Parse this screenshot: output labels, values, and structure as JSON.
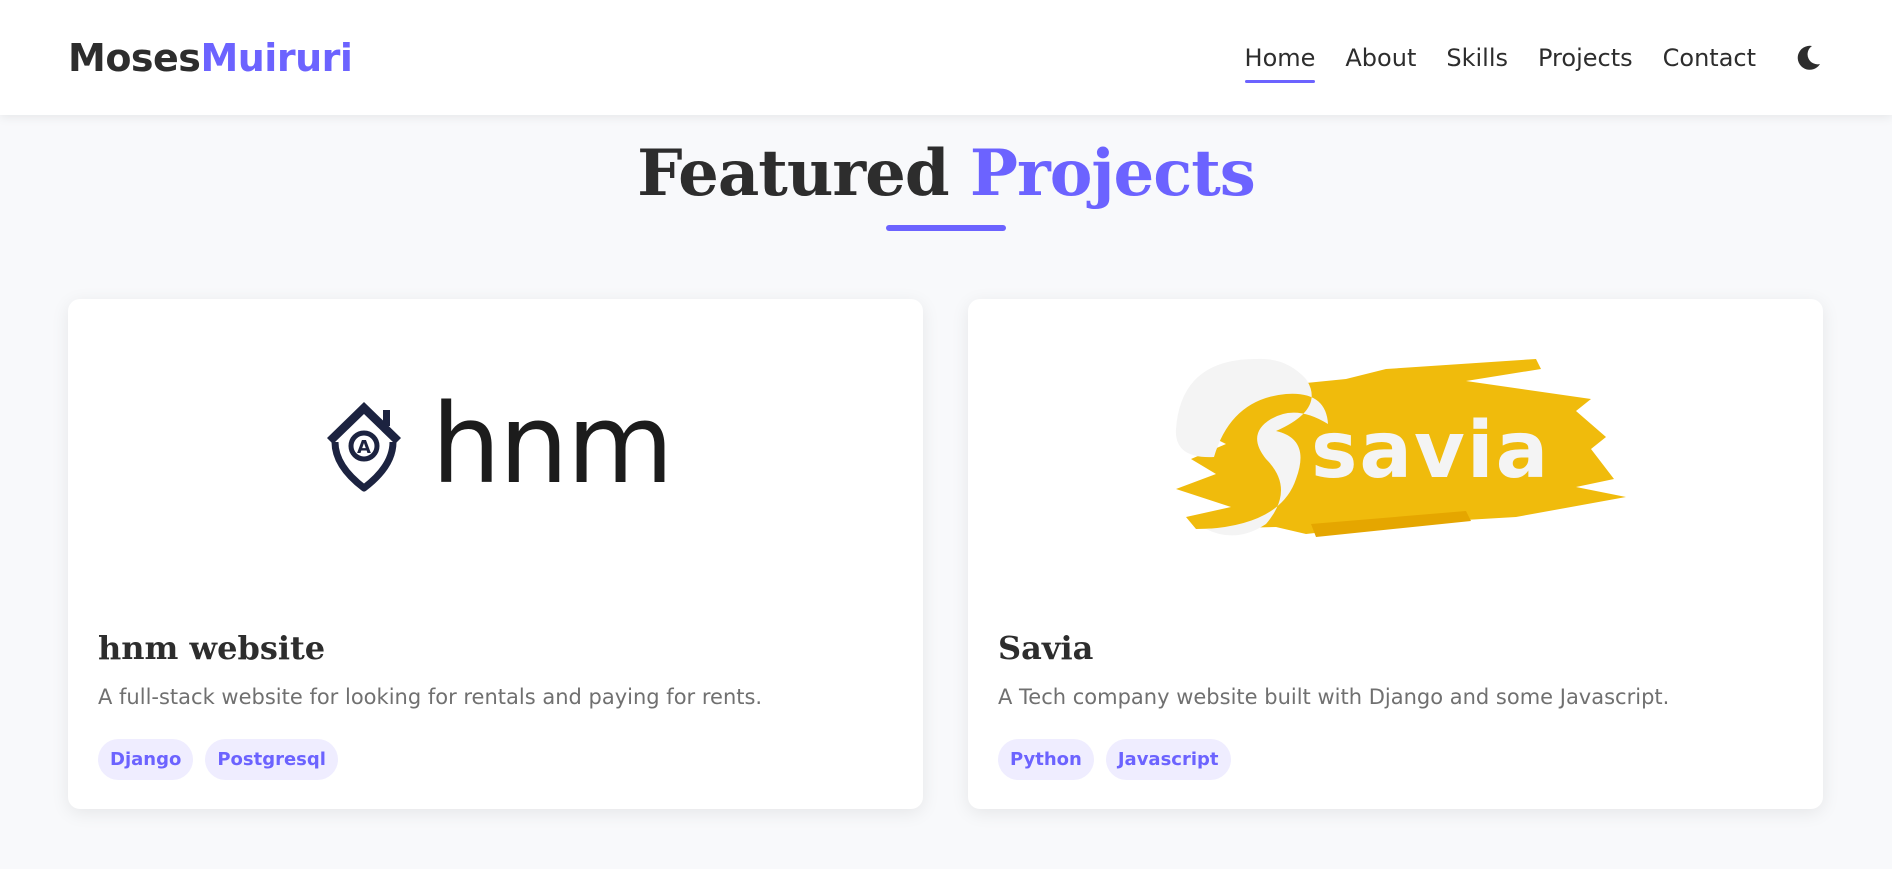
{
  "brand": {
    "first": "Moses",
    "second": "Muiruri"
  },
  "nav": {
    "items": [
      {
        "label": "Home",
        "active": true
      },
      {
        "label": "About",
        "active": false
      },
      {
        "label": "Skills",
        "active": false
      },
      {
        "label": "Projects",
        "active": false
      },
      {
        "label": "Contact",
        "active": false
      }
    ],
    "theme_icon": "moon-icon"
  },
  "section": {
    "title_part1": "Featured",
    "title_part2": "Projects"
  },
  "projects": [
    {
      "logo_text": "hnm",
      "title": "hnm website",
      "description": "A full-stack website for looking for rentals and paying for rents.",
      "tags": [
        "Django",
        "Postgresql"
      ]
    },
    {
      "logo_text": "savia",
      "title": "Savia",
      "description": "A Tech company website built with Django and some Javascript.",
      "tags": [
        "Python",
        "Javascript"
      ]
    }
  ],
  "colors": {
    "accent": "#6c63ff",
    "text": "#2d2d2d",
    "muted": "#707070",
    "tag_bg": "#efedff",
    "savia_yellow": "#f0bb0c"
  }
}
